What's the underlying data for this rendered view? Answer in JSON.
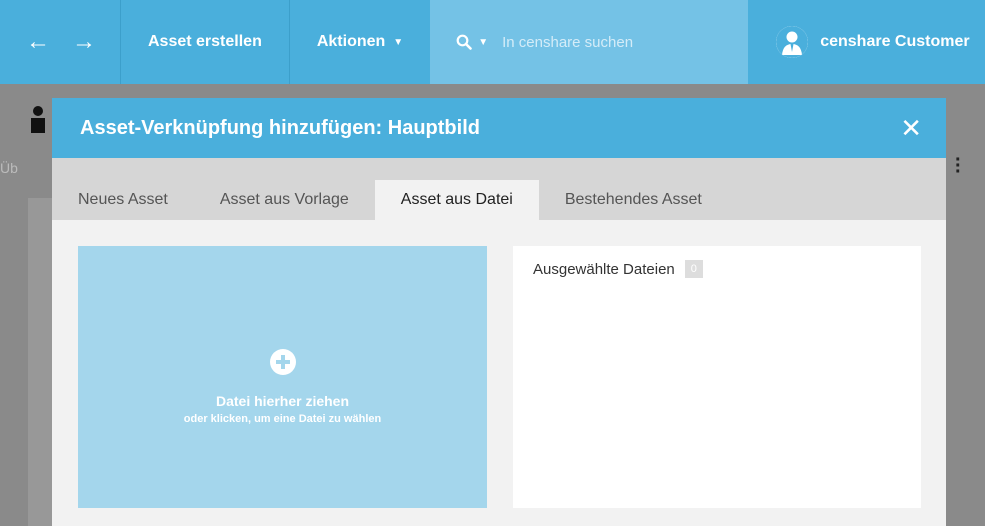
{
  "topbar": {
    "back_icon": "arrow-left-icon",
    "forward_icon": "arrow-right-icon",
    "create_asset_label": "Asset erstellen",
    "actions_label": "Aktionen",
    "search_placeholder": "In censhare suchen",
    "user_name": "censhare Customer"
  },
  "background": {
    "truncated_text": "Üb"
  },
  "modal": {
    "title": "Asset-Verknüpfung hinzufügen: Hauptbild",
    "close_icon": "close-icon",
    "tabs": [
      {
        "label": "Neues Asset",
        "active": false
      },
      {
        "label": "Asset aus Vorlage",
        "active": false
      },
      {
        "label": "Asset aus Datei",
        "active": true
      },
      {
        "label": "Bestehendes Asset",
        "active": false
      }
    ],
    "dropzone": {
      "title": "Datei hierher ziehen",
      "subtitle": "oder klicken, um eine Datei zu wählen"
    },
    "selected_files": {
      "label": "Ausgewählte Dateien",
      "count": "0"
    }
  },
  "colors": {
    "accent": "#4aafdc",
    "search_bg": "#74c2e6",
    "dropzone_bg": "#a4d6ec",
    "overlay": "#8a8a8a"
  }
}
